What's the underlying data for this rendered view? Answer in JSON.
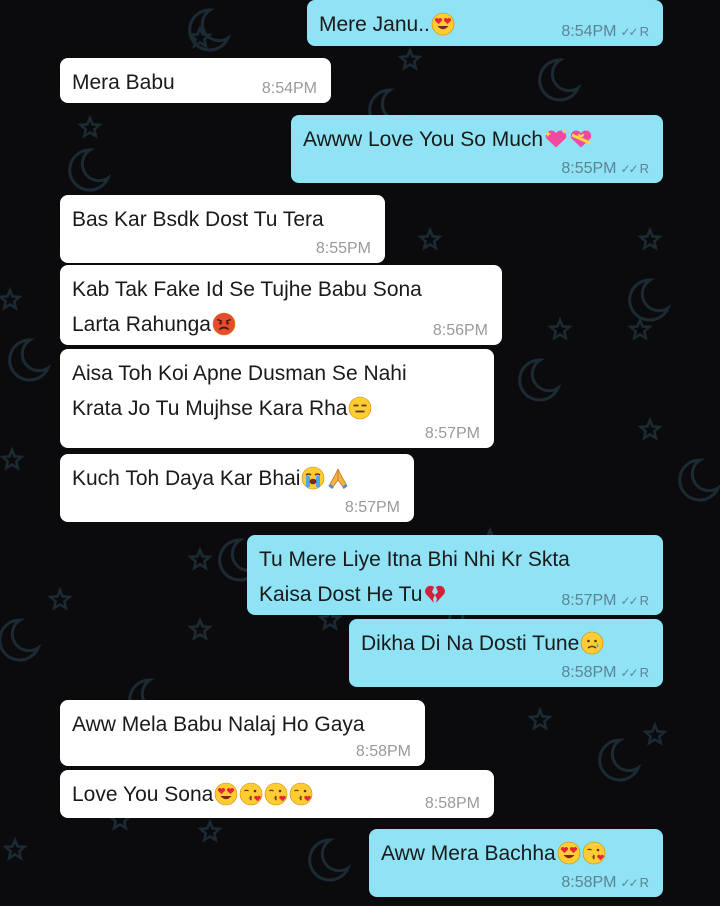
{
  "messages": [
    {
      "side": "out",
      "text": "Mere Janu..",
      "emojis": [
        "heart-eyes"
      ],
      "time": "8:54PM",
      "status": "R"
    },
    {
      "side": "in",
      "text": "Mera Babu",
      "emojis": [],
      "time": "8:54PM"
    },
    {
      "side": "out",
      "text": "Awww Love You So Much",
      "emojis": [
        "sparkling-heart",
        "heart-with-ribbon"
      ],
      "time": "8:55PM",
      "status": "R"
    },
    {
      "side": "in",
      "text": "Bas Kar Bsdk Dost Tu Tera",
      "emojis": [],
      "time": "8:55PM"
    },
    {
      "side": "in",
      "text": "Kab Tak Fake Id Se Tujhe Babu Sona\nLarta Rahunga",
      "emojis": [
        "angry-face"
      ],
      "time": "8:56PM"
    },
    {
      "side": "in",
      "text": "Aisa Toh Koi Apne Dusman Se Nahi\nKrata Jo Tu Mujhse Kara Rha",
      "emojis": [
        "expressionless-face"
      ],
      "time": "8:57PM"
    },
    {
      "side": "in",
      "text": "Kuch Toh Daya Kar Bhai",
      "emojis": [
        "crying-face",
        "folded-hands"
      ],
      "time": "8:57PM"
    },
    {
      "side": "out",
      "text": "Tu Mere Liye Itna Bhi Nhi Kr Skta\nKaisa Dost He Tu",
      "emojis": [
        "broken-heart"
      ],
      "time": "8:57PM",
      "status": "R"
    },
    {
      "side": "out",
      "text": "Dikha Di Na Dosti Tune",
      "emojis": [
        "sad-tear-face"
      ],
      "time": "8:58PM",
      "status": "R"
    },
    {
      "side": "in",
      "text": "Aww Mela Babu Nalaj Ho Gaya",
      "emojis": [],
      "time": "8:58PM"
    },
    {
      "side": "in",
      "text": "Love You Sona",
      "emojis": [
        "heart-eyes",
        "kissing-heart",
        "kissing-heart",
        "kissing-heart"
      ],
      "time": "8:58PM"
    },
    {
      "side": "out",
      "text": "Aww Mera Bachha",
      "emojis": [
        "heart-eyes",
        "kissing-heart"
      ],
      "time": "8:58PM",
      "status": "R"
    }
  ],
  "colors": {
    "background": "#0b0b0d",
    "incoming_bubble": "#ffffff",
    "outgoing_bubble": "#8fe3f5",
    "pattern": "#1c2a33"
  }
}
